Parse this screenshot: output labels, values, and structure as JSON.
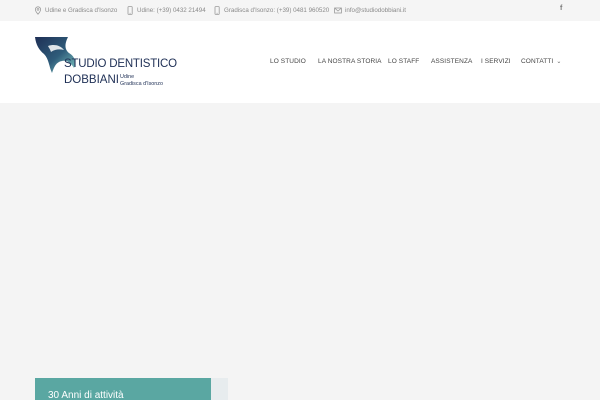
{
  "topbar": {
    "location": {
      "text": "Udine e Gradisca d'Isonzo",
      "icon": "map-pin-icon"
    },
    "phone_udine": {
      "text": "Udine: (+39) 0432 21494",
      "icon": "phone-icon"
    },
    "phone_gradisca": {
      "text": "Gradisca d'Isonzo: (+39) 0481 960520",
      "icon": "phone-icon"
    },
    "email": {
      "text": "info@studiodobbiani.it",
      "icon": "envelope-icon"
    },
    "social": {
      "facebook": "f"
    }
  },
  "logo": {
    "title": "STUDIO DENTISTICO",
    "name": "DOBBIANI",
    "location_line1": "Udine",
    "location_line2": "Gradisca d'Isonzo",
    "colors": {
      "navy": "#1e2f55",
      "teal": "#5aa7a2"
    }
  },
  "nav": {
    "items": [
      {
        "label": "LO STUDIO"
      },
      {
        "label": "LA NOSTRA STORIA"
      },
      {
        "label": "LO STAFF"
      },
      {
        "label": "ASSISTENZA"
      },
      {
        "label": "I SERVIZI"
      },
      {
        "label": "CONTATTI",
        "dropdown": true
      }
    ]
  },
  "card": {
    "title": "30 Anni di attività"
  },
  "colors": {
    "accent": "#5aa7a2",
    "page_bg": "#f4f4f4",
    "topbar_bg": "#f5f5f5"
  }
}
